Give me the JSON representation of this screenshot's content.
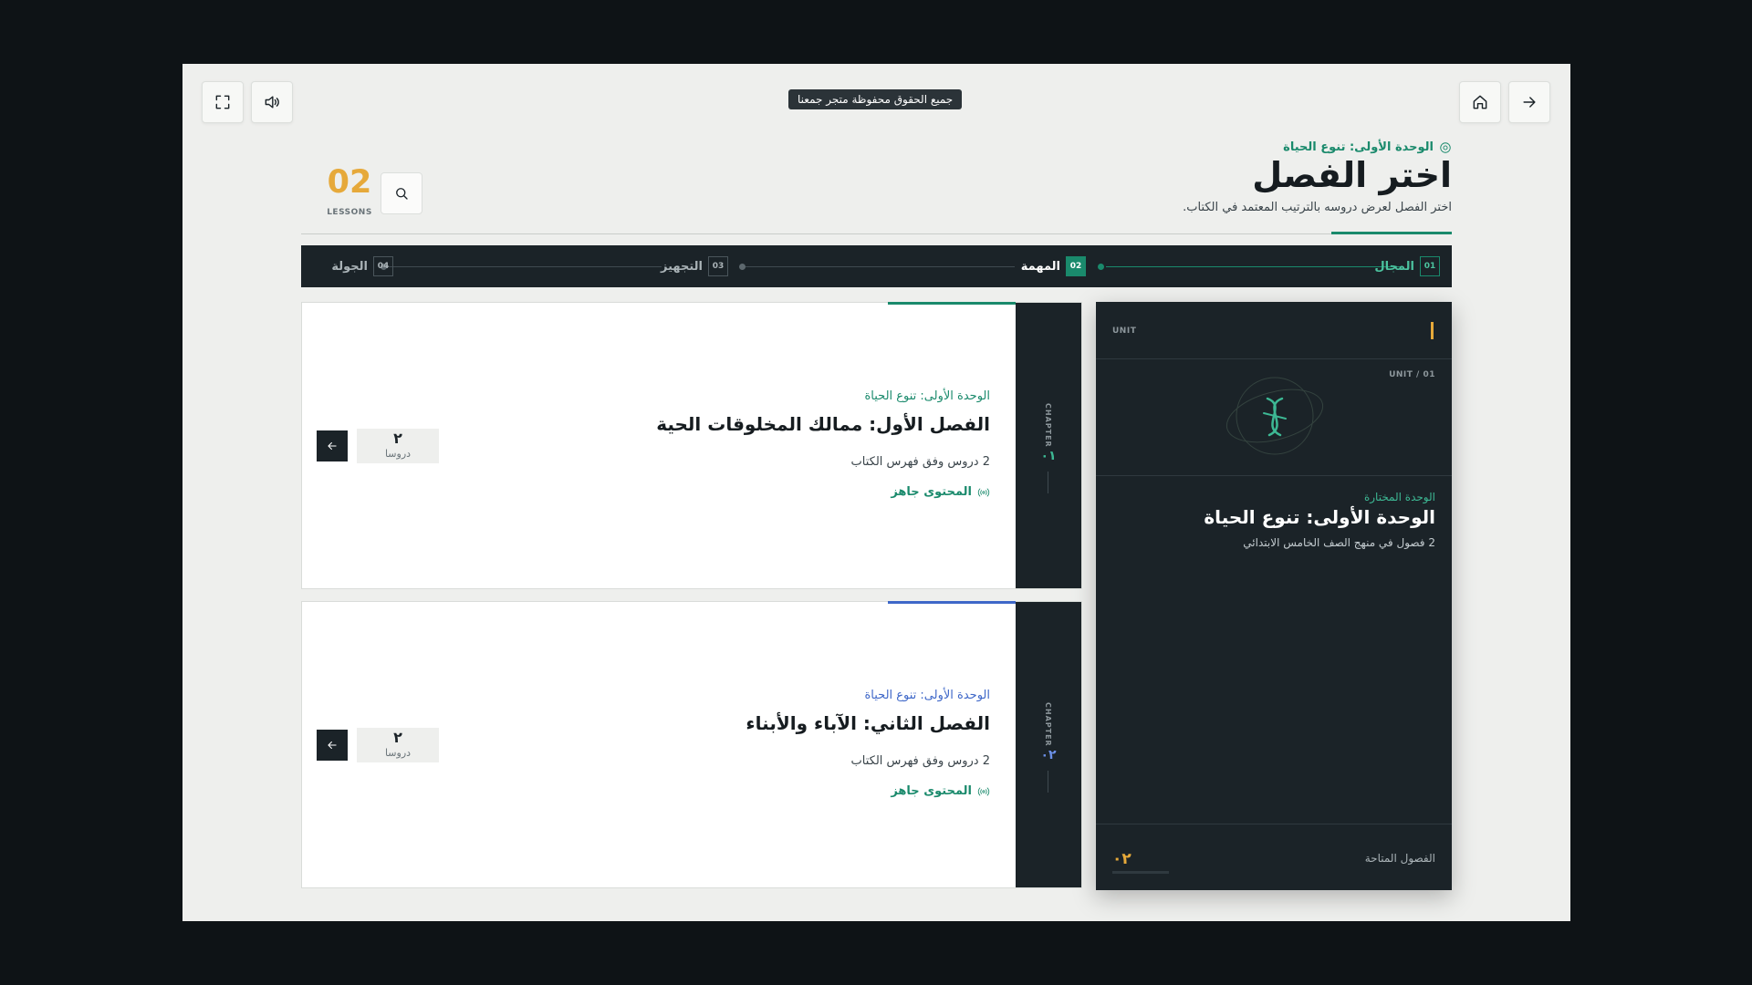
{
  "header": {
    "copyright": "جميع الحقوق محفوظة متجر جمعنا",
    "breadcrumb": "الوحدة الأولى: تنوع الحياة",
    "title": "اختر الفصل",
    "subtitle": "اختر الفصل لعرض دروسه بالترتيب المعتمد في الكتاب.",
    "lessons_count": "02",
    "lessons_label": "LESSONS"
  },
  "stepper": {
    "steps": [
      {
        "num": "01",
        "label": "المجال",
        "state": "done"
      },
      {
        "num": "02",
        "label": "المهمة",
        "state": "active"
      },
      {
        "num": "03",
        "label": "التجهيز",
        "state": "todo"
      },
      {
        "num": "04",
        "label": "الجولة",
        "state": "todo"
      }
    ]
  },
  "unit_card": {
    "tag": "UNIT",
    "sub": "UNIT / 01",
    "selected_label": "الوحدة المختارة",
    "name": "الوحدة الأولى: تنوع الحياة",
    "desc": "2 فصول في منهج الصف الخامس الابتدائي",
    "available_label": "الفصول المتاحة",
    "available_count": "٠٢",
    "accent": "#e6a93a"
  },
  "chapters": [
    {
      "rail_label": "CHAPTER",
      "rail_num": "٠١",
      "unit": "الوحدة الأولى: تنوع الحياة",
      "title": "الفصل الأول: ممالك المخلوقات الحية",
      "desc": "2 دروس وفق فهرس الكتاب",
      "ready": "المحتوى جاهز",
      "count": "٢",
      "count_label": "دروسا",
      "accent": "#1a8a6c"
    },
    {
      "rail_label": "CHAPTER",
      "rail_num": "٠٢",
      "unit": "الوحدة الأولى: تنوع الحياة",
      "title": "الفصل الثاني: الآباء والأبناء",
      "desc": "2 دروس وفق فهرس الكتاب",
      "ready": "المحتوى جاهز",
      "count": "٢",
      "count_label": "دروسا",
      "accent": "#3e67c8"
    }
  ],
  "icons": {
    "fullscreen": "fullscreen-icon",
    "volume": "volume-icon",
    "home": "home-icon",
    "forward": "arrow-right-icon",
    "search": "search-icon",
    "unit_badge": "target-icon",
    "ready": "broadcast-icon",
    "go": "arrow-left-icon"
  }
}
